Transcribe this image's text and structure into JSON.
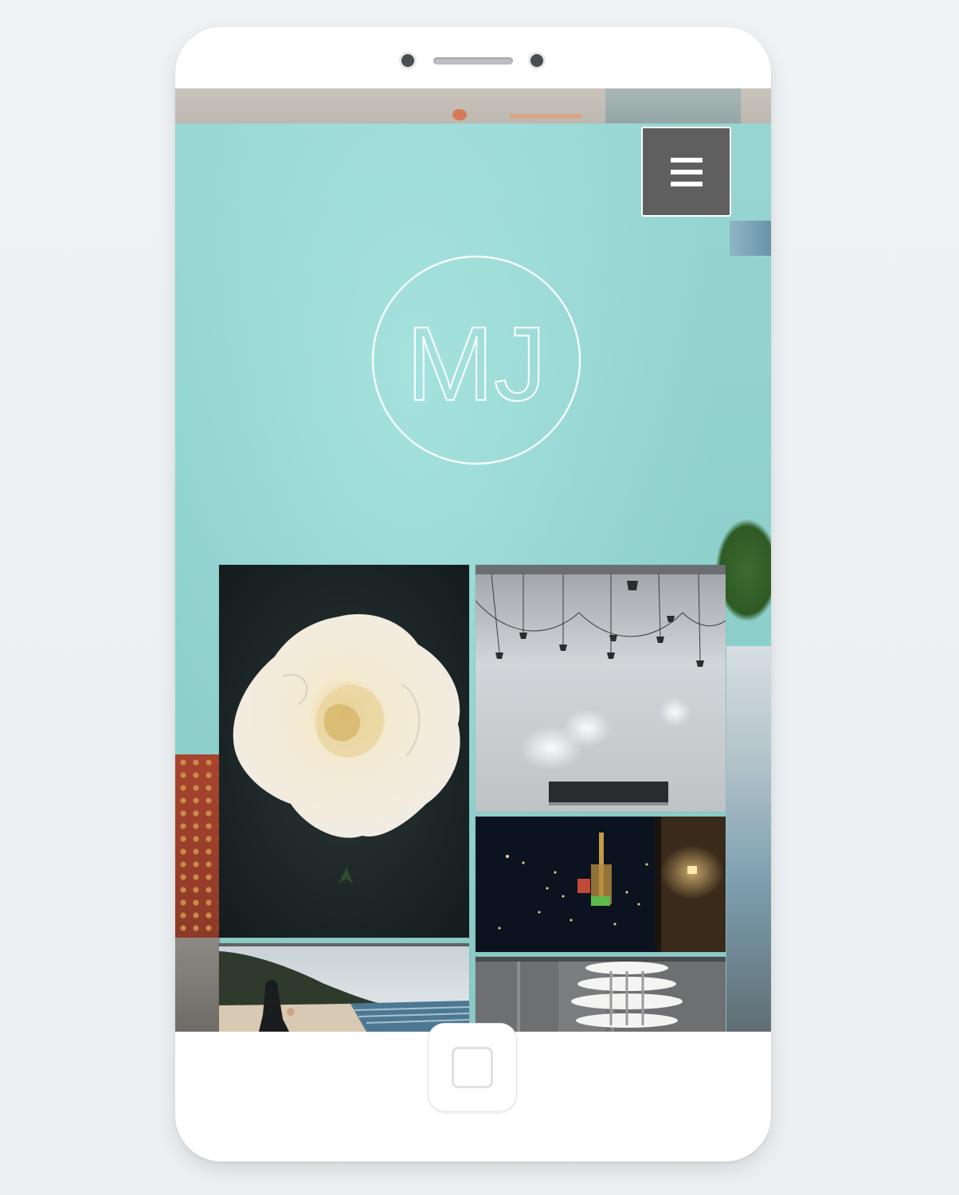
{
  "logo": {
    "text": "MJ"
  },
  "menu": {
    "icon": "hamburger-menu-icon"
  },
  "gallery": [
    {
      "name": "white-rose-photo"
    },
    {
      "name": "pendant-lights-photo"
    },
    {
      "name": "night-city-photo"
    },
    {
      "name": "beach-person-photo"
    },
    {
      "name": "lamp-photo"
    }
  ],
  "colors": {
    "wall": "#8fd3d0",
    "menu_button": "#5f5f60",
    "phone_body": "#ffffff"
  }
}
